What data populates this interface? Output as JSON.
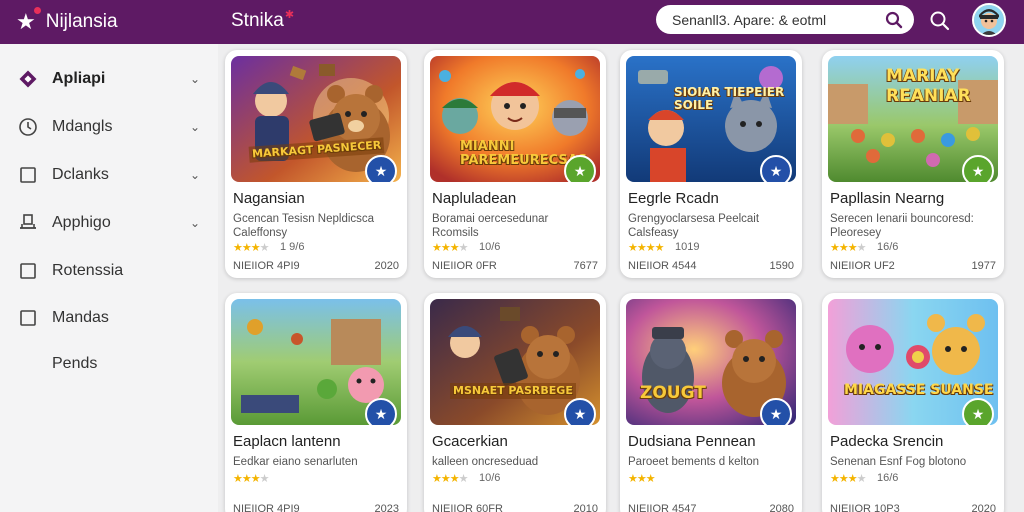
{
  "header": {
    "brand": "Nijlansia",
    "brand2": "Stnika",
    "search_value": "Senanll3. Apare: & eotml"
  },
  "sidebar": {
    "items": [
      {
        "label": "Apliapi",
        "icon": "diamond-icon",
        "chevron": true
      },
      {
        "label": "Mdangls",
        "icon": "clock-icon",
        "chevron": true
      },
      {
        "label": "Dclanks",
        "icon": "square-icon",
        "chevron": true
      },
      {
        "label": "Apphigo",
        "icon": "monitor-icon",
        "chevron": true
      },
      {
        "label": "Rotenssia",
        "icon": "square-icon",
        "chevron": false
      },
      {
        "label": "Mandas",
        "icon": "square-icon",
        "chevron": false
      },
      {
        "label": "Pends",
        "icon": "",
        "chevron": false
      }
    ]
  },
  "cards": [
    {
      "title": "Nagansian",
      "desc": "Gcencan Tesisn Nepldicsca Caleffonsy",
      "stars": 3.5,
      "rating": "1 9/6",
      "meta": "NIEIIOR 4PI9",
      "year": "2020",
      "overlay": "MARKAGT PASNECER",
      "badge_color": "#2350a8"
    },
    {
      "title": "Napluladean",
      "desc": "Boramai oercesedunar Rcomsils",
      "stars": 3.5,
      "rating": "10/6",
      "meta": "NIEIIOR 0FR",
      "year": "7677",
      "overlay": "MIANNI PAREMEURECSAS",
      "badge_color": "#5aa52c"
    },
    {
      "title": "Eegrle Rcadn",
      "desc": "Grengyoclarsesa Peelcait Calsfeasy",
      "stars": 4,
      "rating": "1019",
      "meta": "NIEIIOR 4544",
      "year": "1590",
      "overlay": "SIOIAR TIEPEIER SOILE",
      "badge_color": "#2350a8"
    },
    {
      "title": "Papllasin Nearng",
      "desc": "Serecen Ienarii bouncoresd: Pleoresey",
      "stars": 3.5,
      "rating": "16/6",
      "meta": "NIEIIOR UF2",
      "year": "1977",
      "overlay": "MARIAY REANIAR",
      "badge_color": "#5aa52c"
    },
    {
      "title": "Eaplacn lantenn",
      "desc": "Eedkar eiano senarluten",
      "stars": 3.5,
      "rating": "",
      "meta": "NIEIIOR 4PI9",
      "year": "2023",
      "overlay": "",
      "badge_color": "#2350a8"
    },
    {
      "title": "Gcacerkian",
      "desc": "kalleen oncreseduad",
      "stars": 3.5,
      "rating": "10/6",
      "meta": "NIEIIOR 60FR",
      "year": "2010",
      "overlay": "MSNAET PASRBEGE",
      "badge_color": "#2350a8"
    },
    {
      "title": "Dudsiana Pennean",
      "desc": "Paroeet bements d kelton",
      "stars": 3,
      "rating": "",
      "meta": "NIEIIOR 4547",
      "year": "2080",
      "overlay": "ZOUGT",
      "badge_color": "#2350a8"
    },
    {
      "title": "Padecka Srencin",
      "desc": "Senenan Esnf Fog blotono",
      "stars": 3.5,
      "rating": "16/6",
      "meta": "NIEIIOR 10P3",
      "year": "2020",
      "overlay": "MIAGASSE SUANSE",
      "badge_color": "#5aa52c"
    }
  ]
}
